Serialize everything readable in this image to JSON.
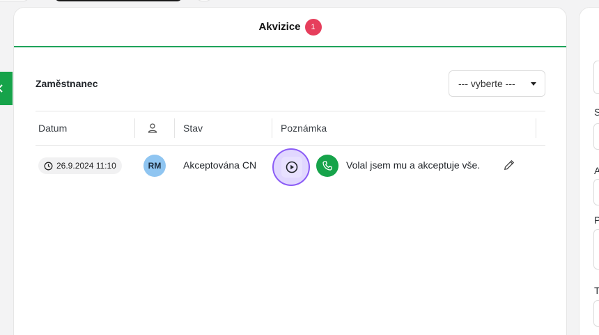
{
  "card": {
    "title": "Akvizice",
    "badge_count": "1"
  },
  "filter": {
    "label": "Zaměstnanec",
    "select_value": "--- vyberte ---"
  },
  "table": {
    "headers": {
      "date": "Datum",
      "status": "Stav",
      "note": "Poznámka"
    },
    "rows": [
      {
        "date": "26.9.2024 11:10",
        "avatar_initials": "RM",
        "status": "Akceptována CN",
        "note": "Volal jsem mu a akceptuje vše."
      }
    ]
  },
  "right_panel": {
    "letters": [
      "S",
      "A",
      "P",
      "T"
    ]
  },
  "colors": {
    "accent_green": "#16a34a",
    "badge_red": "#e63e5c",
    "avatar_blue": "#8fc5f1",
    "focus_purple": "#8b5cf6"
  },
  "icons": [
    "chevron-left-icon",
    "person-icon",
    "clock-icon",
    "play-icon",
    "phone-icon",
    "pencil-icon",
    "caret-down-icon"
  ]
}
